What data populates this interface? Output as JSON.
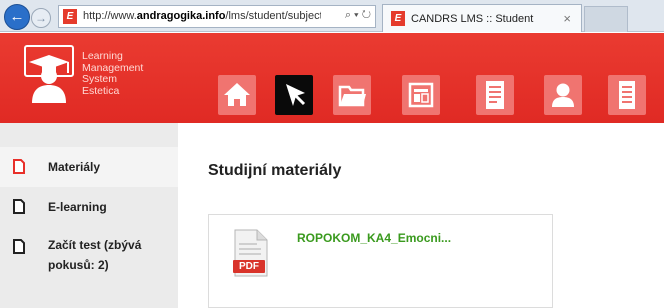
{
  "browser": {
    "url_prefix": "http://www.",
    "url_domain": "andragogika.info",
    "url_path": "/lms/student/subject/ma",
    "address_tools": "⌕ ▾ ↻",
    "tab_title": "CANDRS LMS :: Student",
    "tab_close": "×",
    "back_glyph": "←",
    "forward_glyph": "→",
    "favicon_letter": "E"
  },
  "logo": {
    "line1": "Learning",
    "line2": "Management",
    "line3": "System",
    "line4": "Estetica"
  },
  "menu": [
    {
      "label": "Domů",
      "icon": "home-icon"
    },
    {
      "label": "Předměty",
      "icon": "subjects-icon"
    },
    {
      "label": "Materiály",
      "icon": "folder-icon"
    },
    {
      "label": "E-learning",
      "icon": "elearning-icon"
    },
    {
      "label": "Testy",
      "icon": "tests-icon"
    },
    {
      "label": "Můj profil",
      "icon": "profile-icon"
    },
    {
      "label": "E-index",
      "icon": "eindex-icon"
    }
  ],
  "sidebar": {
    "items": [
      {
        "label": "Materiály",
        "active": true
      },
      {
        "label": "E-learning",
        "active": false
      },
      {
        "label_line1": "Začít test (zbývá",
        "label_line2": "pokusů: 2)",
        "active": false
      }
    ]
  },
  "main": {
    "title": "Studijní materiály",
    "file_name": "ROPOKOM_KA4_Emocni...",
    "file_badge": "PDF"
  },
  "colors": {
    "header_red": "#e8302a",
    "tile_pink": "#f07470",
    "active_tile": "#0a0a0a",
    "link_green": "#3a9a1e"
  }
}
